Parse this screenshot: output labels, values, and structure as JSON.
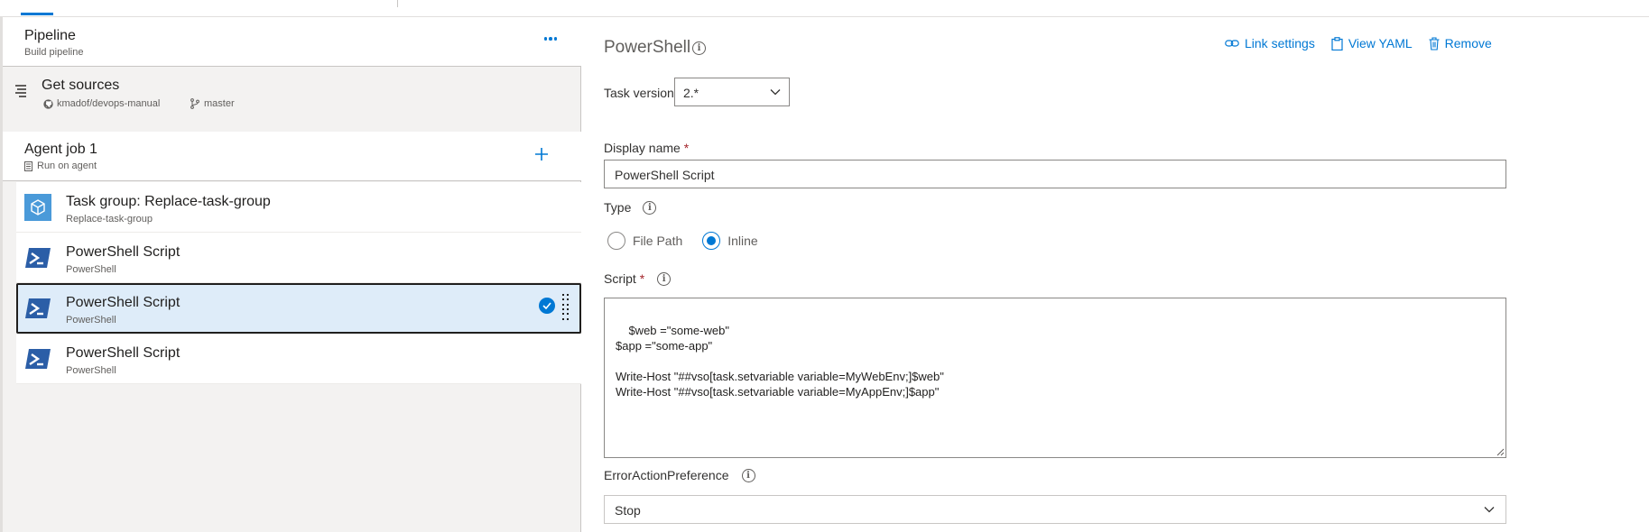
{
  "pipeline": {
    "title": "Pipeline",
    "subtitle": "Build pipeline"
  },
  "sources": {
    "title": "Get sources",
    "repo": "kmadof/devops-manual",
    "branch": "master"
  },
  "agent_job": {
    "title": "Agent job 1",
    "subtitle": "Run on agent"
  },
  "tasks": [
    {
      "title": "Task group: Replace-task-group",
      "subtitle": "Replace-task-group",
      "icon": "task-group-icon",
      "selected": false
    },
    {
      "title": "PowerShell Script",
      "subtitle": "PowerShell",
      "icon": "powershell-icon",
      "selected": false
    },
    {
      "title": "PowerShell Script",
      "subtitle": "PowerShell",
      "icon": "powershell-icon",
      "selected": true
    },
    {
      "title": "PowerShell Script",
      "subtitle": "PowerShell",
      "icon": "powershell-icon",
      "selected": false
    }
  ],
  "detail": {
    "title": "PowerShell",
    "actions": {
      "link_settings": "Link settings",
      "view_yaml": "View YAML",
      "remove": "Remove"
    },
    "task_version": {
      "label": "Task version",
      "value": "2.*"
    },
    "display_name": {
      "label": "Display name",
      "required": "*",
      "value": "PowerShell Script"
    },
    "type": {
      "label": "Type",
      "options": [
        "File Path",
        "Inline"
      ],
      "selected": "Inline"
    },
    "script": {
      "label": "Script",
      "required": "*",
      "value": "$web =\"some-web\"\n$app =\"some-app\"\n\nWrite-Host \"##vso[task.setvariable variable=MyWebEnv;]$web\"\nWrite-Host \"##vso[task.setvariable variable=MyAppEnv;]$app\""
    },
    "error_action": {
      "label": "ErrorActionPreference",
      "value": "Stop"
    }
  },
  "colors": {
    "accent": "#0078d4",
    "selected_bg": "#deecf9",
    "panel_bg": "#f3f2f1",
    "powershell": "#2b5ea7",
    "required": "#a4262c"
  }
}
